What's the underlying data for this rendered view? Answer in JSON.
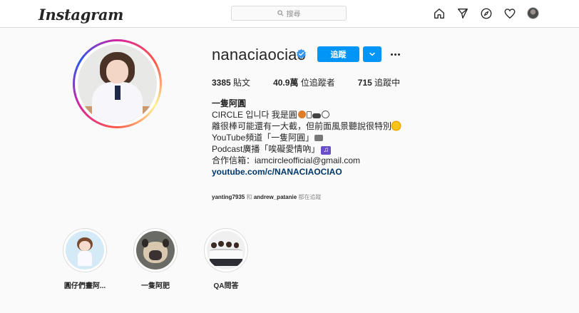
{
  "header": {
    "logo": "Instagram",
    "search_placeholder": "搜尋",
    "icons": [
      "home-icon",
      "direct-send-icon",
      "explore-compass-icon",
      "heart-icon",
      "profile-avatar"
    ]
  },
  "profile": {
    "username": "nanaciaociao",
    "verified": true,
    "follow_label": "追蹤",
    "stats": [
      {
        "count": "3385",
        "label": "貼文"
      },
      {
        "count": "40.9萬",
        "label": "位追蹤者"
      },
      {
        "count": "715",
        "label": "追蹤中"
      }
    ],
    "bio": {
      "name": "一隻阿圓",
      "lines": [
        "CIRCLE 입니다 我是圓",
        "離很棒可能還有一大截，但前面風景聽說很特別",
        "YouTube頻道「一隻阿圓」",
        "Podcast廣播「唉礙愛情吶」",
        "合作信箱：iamcircleofficial@gmail.com"
      ],
      "link": "youtube.com/c/NANACIAOCIAO"
    },
    "followed_by": {
      "user1": "yanting7935",
      "and": "和",
      "user2": "andrew_patanie",
      "suffix": "都在追蹤"
    }
  },
  "highlights": [
    {
      "label": "圓仔們畫阿..."
    },
    {
      "label": "一隻阿肥"
    },
    {
      "label": "QA問答"
    }
  ],
  "colors": {
    "accent": "#0095f6",
    "link": "#00376b",
    "muted": "#8e8e8e"
  }
}
